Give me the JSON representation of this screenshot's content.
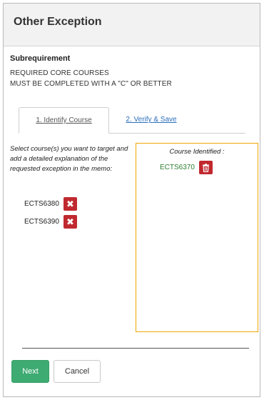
{
  "header": {
    "title": "Other Exception"
  },
  "subrequirement": {
    "heading": "Subrequirement",
    "line1": "REQUIRED CORE COURSES",
    "line2": "MUST BE COMPLETED WITH A \"C\" OR BETTER"
  },
  "tabs": [
    {
      "label": "1. Identify Course",
      "active": true
    },
    {
      "label": "2. Verify & Save",
      "active": false
    }
  ],
  "target": {
    "instructions": "Select course(s) you want to target and add a detailed explanation of the requested exception in the memo:",
    "courses": [
      "ECTS6380",
      "ECTS6390"
    ]
  },
  "identified": {
    "title": "Course Identified :",
    "course": "ECTS6370"
  },
  "actions": {
    "next_label": "Next",
    "cancel_label": "Cancel"
  },
  "colors": {
    "next_button": "#3eab72",
    "remove_button": "#c0292f",
    "identified_border": "#f0a500",
    "identified_text": "#2e7d32",
    "link": "#2a6ebb"
  },
  "icons": {
    "remove": "close-icon",
    "delete": "trash-icon"
  }
}
